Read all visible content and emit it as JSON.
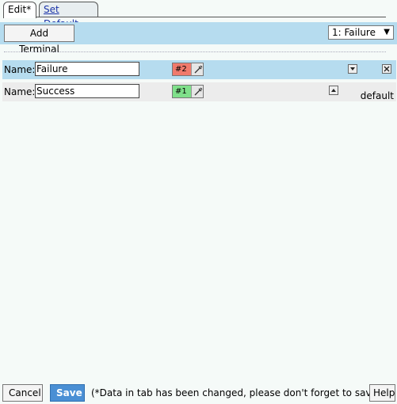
{
  "tabs": [
    {
      "label": "Edit*"
    },
    {
      "label": "Set Default"
    }
  ],
  "toolbar": {
    "add_terminal_label": "Add Terminal",
    "selected_terminal": "1: Failure"
  },
  "terminals": [
    {
      "name_label": "Name:",
      "name_value": "Failure",
      "color_number": "#2",
      "color": "#f07a6c"
    },
    {
      "name_label": "Name:",
      "name_value": "Success",
      "color_number": "#1",
      "color": "#7fe08a",
      "default_label": "default"
    }
  ],
  "footer": {
    "cancel_label": "Cancel",
    "save_label": "Save",
    "note": "(*Data in tab has been changed, please don't forget to save)",
    "help_label": "Help"
  },
  "colors": {
    "toolbar_bg": "#b6dcef",
    "save_bg": "#4a8fd4"
  }
}
